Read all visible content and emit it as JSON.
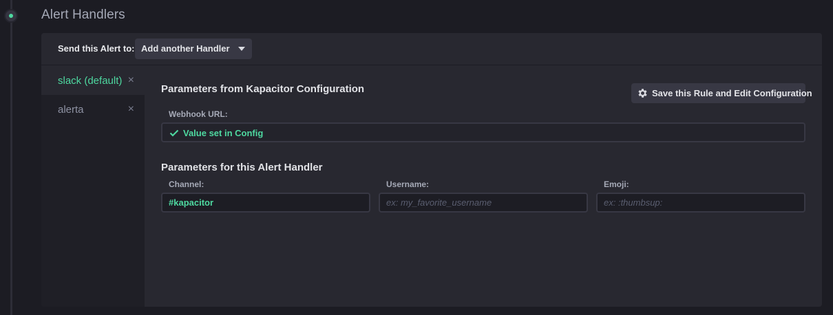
{
  "section": {
    "title": "Alert Handlers"
  },
  "header": {
    "send_label": "Send this Alert to:",
    "dropdown_label": "Add another Handler"
  },
  "tabs": [
    {
      "label": "slack (default)",
      "close": "×",
      "active": true
    },
    {
      "label": "alerta",
      "close": "×",
      "active": false
    }
  ],
  "config_section": {
    "title": "Parameters from Kapacitor Configuration",
    "save_button_label": "Save this Rule and Edit Configuration",
    "webhook_label": "Webhook URL:",
    "webhook_value": "Value set in Config"
  },
  "handler_section": {
    "title": "Parameters for this Alert Handler",
    "fields": [
      {
        "label": "Channel:",
        "value": "#kapacitor",
        "placeholder": ""
      },
      {
        "label": "Username:",
        "value": "",
        "placeholder": "ex: my_favorite_username"
      },
      {
        "label": "Emoji:",
        "value": "",
        "placeholder": "ex: :thumbsup:"
      }
    ]
  },
  "icons": {
    "timeline": "timeline-node-icon",
    "dropdown": "caret-down-icon",
    "close": "close-icon",
    "save": "gear-icon",
    "config_status": "check-icon"
  },
  "colors": {
    "accent": "#4ed8a0",
    "page_background": "#1c1c23",
    "panel_background": "#282830",
    "sidebar_background": "#1f1f26",
    "button_background": "#383844"
  }
}
